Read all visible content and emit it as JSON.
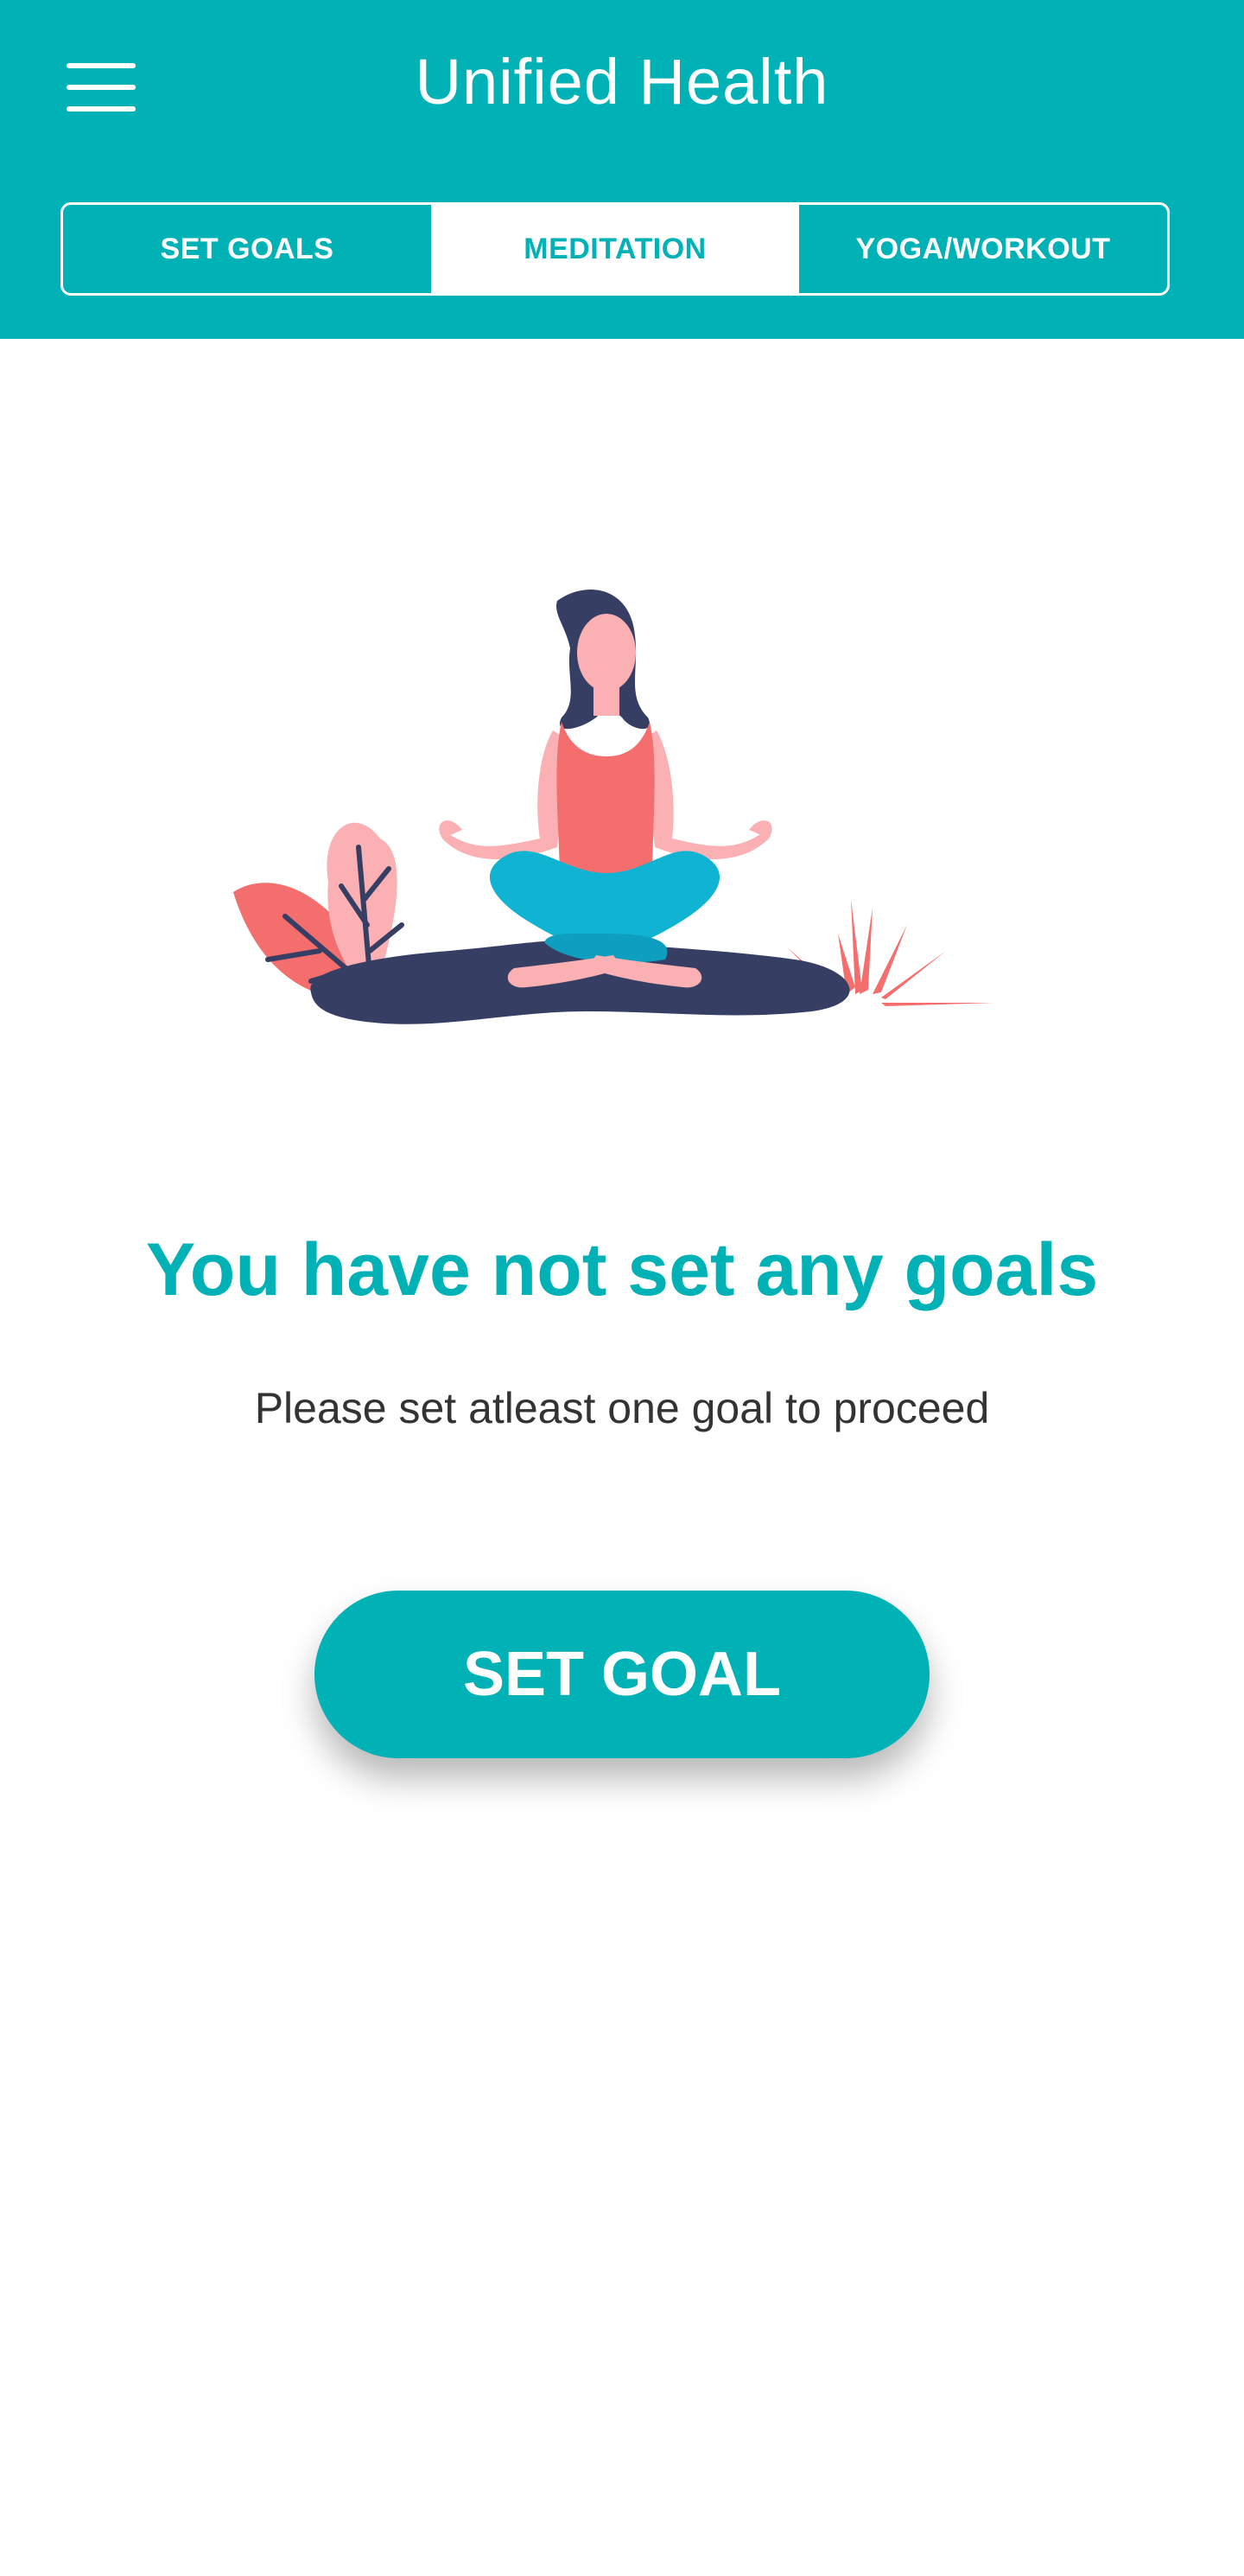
{
  "app_bar": {
    "title": "Unified Health",
    "menu_icon": "hamburger-menu-icon",
    "background_color": "#00b2b5"
  },
  "tabs": [
    {
      "label": "SET GOALS",
      "active": false
    },
    {
      "label": "MEDITATION",
      "active": true
    },
    {
      "label": "YOGA/WORKOUT",
      "active": false
    }
  ],
  "empty_state": {
    "illustration": "meditation-woman-illustration",
    "title": "You have not set any goals",
    "subtitle": "Please set atleast one goal to proceed",
    "button_label": "SET GOAL"
  },
  "colors": {
    "accent": "#00b2b5",
    "text_dark": "#333333",
    "illustration_navy": "#363f63",
    "illustration_coral": "#f46e6e",
    "illustration_pink": "#fbb1b3",
    "illustration_cyan": "#10b3d2"
  }
}
